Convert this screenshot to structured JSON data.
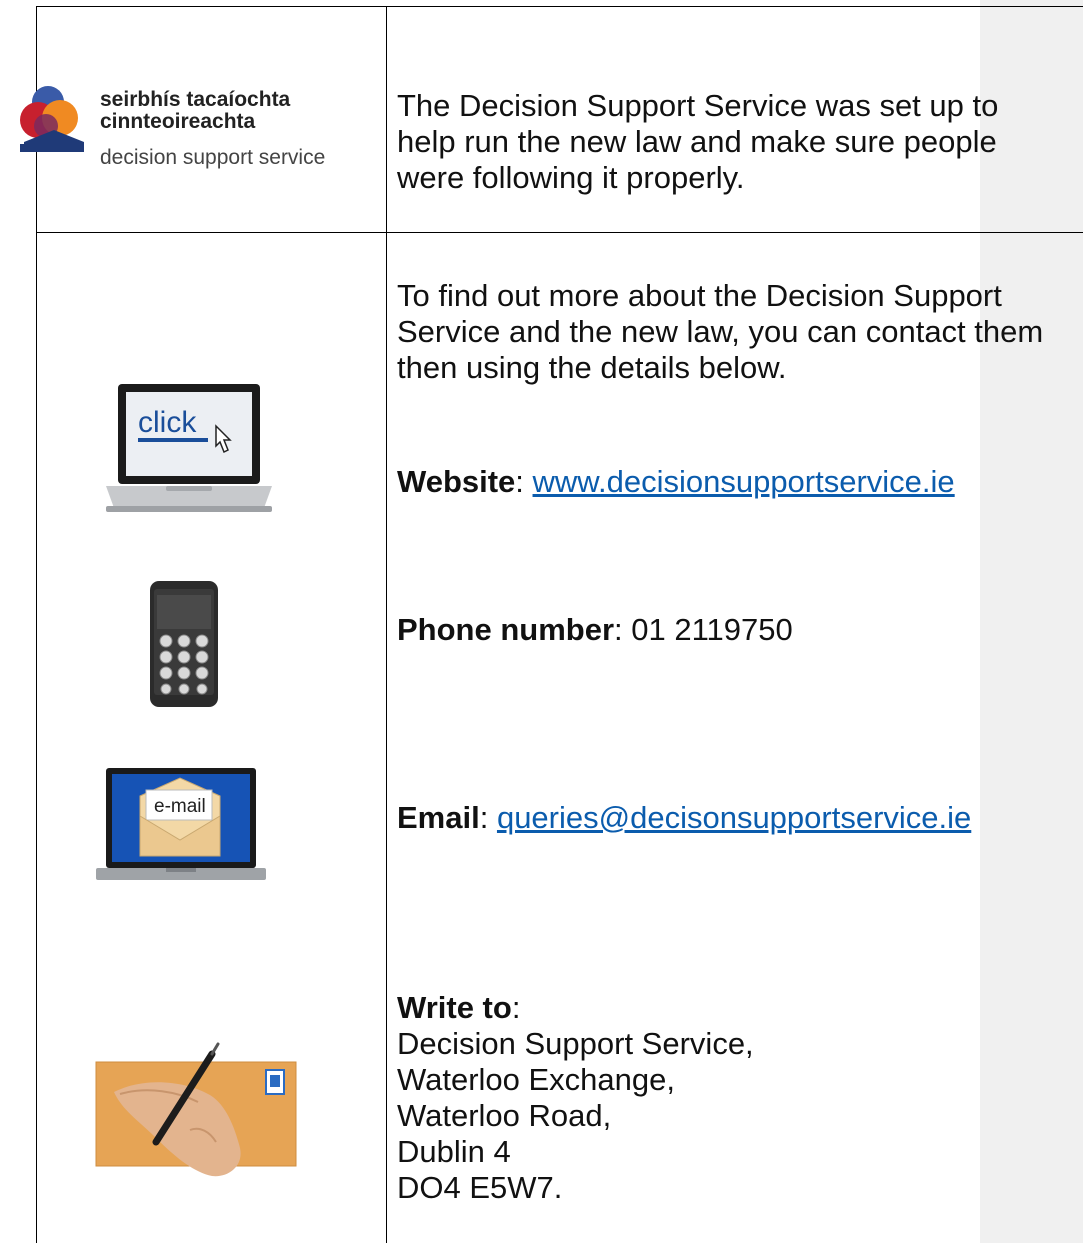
{
  "logo": {
    "line1": "seirbhís tacaíochta",
    "line2": "cinnteoireachta",
    "line3": "decision support service"
  },
  "intro": {
    "text_lines": [
      "The Decision Support Service was set up to",
      "help run the new law and make sure people",
      "were following it properly."
    ]
  },
  "contact": {
    "intro_lines": [
      "To find out more about the Decision Support",
      "Service and the new law, you can contact them",
      "then using the details below."
    ],
    "website_label": "Website",
    "website_value": "www.decisionsupportservice.ie",
    "phone_label": "Phone number",
    "phone_value": "01 2119750",
    "email_label": "Email",
    "email_value": "queries@decisonsupportservice.ie",
    "write_label": "Write to",
    "address_lines": [
      "Decision Support Service,",
      "Waterloo Exchange,",
      "Waterloo Road,",
      "Dublin 4",
      "DO4 E5W7."
    ]
  },
  "icons": {
    "laptop_click_text": "click",
    "email_envelope_text": "e-mail"
  }
}
